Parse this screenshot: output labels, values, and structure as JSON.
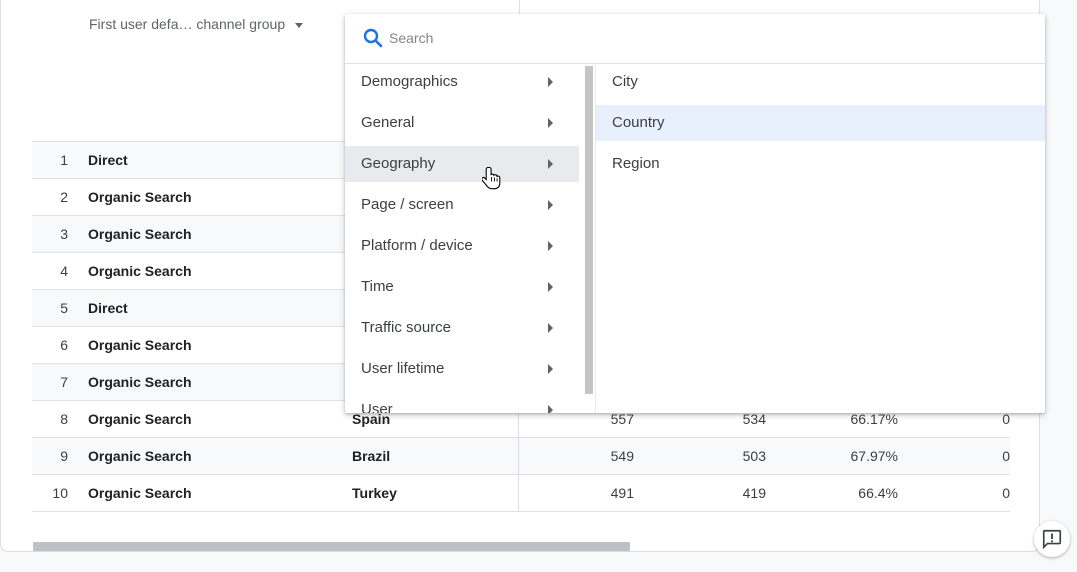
{
  "table": {
    "dimension_header": "First user defa… channel group",
    "rows": [
      {
        "idx": "1",
        "channel": "Direct",
        "country": "",
        "v1": "",
        "v2": "",
        "v3": "",
        "v4": ""
      },
      {
        "idx": "2",
        "channel": "Organic Search",
        "country": "",
        "v1": "",
        "v2": "",
        "v3": "",
        "v4": ""
      },
      {
        "idx": "3",
        "channel": "Organic Search",
        "country": "",
        "v1": "",
        "v2": "",
        "v3": "",
        "v4": ""
      },
      {
        "idx": "4",
        "channel": "Organic Search",
        "country": "",
        "v1": "",
        "v2": "",
        "v3": "",
        "v4": ""
      },
      {
        "idx": "5",
        "channel": "Direct",
        "country": "",
        "v1": "",
        "v2": "",
        "v3": "",
        "v4": ""
      },
      {
        "idx": "6",
        "channel": "Organic Search",
        "country": "",
        "v1": "",
        "v2": "",
        "v3": "",
        "v4": ""
      },
      {
        "idx": "7",
        "channel": "Organic Search",
        "country": "",
        "v1": "",
        "v2": "",
        "v3": "",
        "v4": ""
      },
      {
        "idx": "8",
        "channel": "Organic Search",
        "country": "Spain",
        "v1": "557",
        "v2": "534",
        "v3": "66.17%",
        "v4": "0"
      },
      {
        "idx": "9",
        "channel": "Organic Search",
        "country": "Brazil",
        "v1": "549",
        "v2": "503",
        "v3": "67.97%",
        "v4": "0"
      },
      {
        "idx": "10",
        "channel": "Organic Search",
        "country": "Turkey",
        "v1": "491",
        "v2": "419",
        "v3": "66.4%",
        "v4": "0"
      }
    ]
  },
  "dropdown": {
    "search_placeholder": "Search",
    "categories": [
      {
        "label": "Demographics"
      },
      {
        "label": "General"
      },
      {
        "label": "Geography"
      },
      {
        "label": "Page / screen"
      },
      {
        "label": "Platform / device"
      },
      {
        "label": "Time"
      },
      {
        "label": "Traffic source"
      },
      {
        "label": "User lifetime"
      },
      {
        "label": "User"
      }
    ],
    "active_category": "Geography",
    "subitems": [
      {
        "label": "City"
      },
      {
        "label": "Country"
      },
      {
        "label": "Region"
      }
    ],
    "selected_subitem": "Country"
  },
  "icons": {
    "search": "search-icon",
    "feedback": "feedback-icon",
    "cursor": "hand-pointer-icon"
  },
  "colors": {
    "accent": "#1a73e8",
    "selected_bg": "#e8f0fe",
    "hover_bg": "#e8eaed"
  }
}
